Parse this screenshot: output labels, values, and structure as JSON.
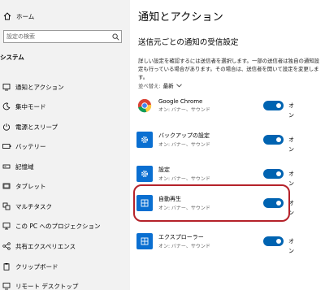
{
  "sidebar": {
    "home_label": "ホーム",
    "search_placeholder": "設定の検索",
    "section_title": "システム",
    "items": [
      {
        "label": "通知とアクション",
        "icon": "notification-icon"
      },
      {
        "label": "集中モード",
        "icon": "moon-icon"
      },
      {
        "label": "電源とスリープ",
        "icon": "power-icon"
      },
      {
        "label": "バッテリー",
        "icon": "battery-icon"
      },
      {
        "label": "記憶域",
        "icon": "storage-icon"
      },
      {
        "label": "タブレット",
        "icon": "tablet-icon"
      },
      {
        "label": "マルチタスク",
        "icon": "multitask-icon"
      },
      {
        "label": "この PC へのプロジェクション",
        "icon": "projection-icon"
      },
      {
        "label": "共有エクスペリエンス",
        "icon": "share-icon"
      },
      {
        "label": "クリップボード",
        "icon": "clipboard-icon"
      },
      {
        "label": "リモート デスクトップ",
        "icon": "remote-desktop-icon"
      }
    ]
  },
  "main": {
    "title": "通知とアクション",
    "subtitle": "送信元ごとの通知の受信設定",
    "description": "詳しい設定を確認するには送信者を選択します。一部の送信者は独自の通知設定も行っている場合があります。その場合は、送信者を開いて設定を変更します。",
    "sort_label": "並べ替え:",
    "sort_value": "最新",
    "apps": [
      {
        "name": "Google Chrome",
        "sub": "オン: バナー、サウンド",
        "toggle_label": "オン",
        "on": true,
        "icon": "chrome-icon"
      },
      {
        "name": "バックアップの設定",
        "sub": "オン: バナー、サウンド",
        "toggle_label": "オン",
        "on": true,
        "icon": "gear-icon"
      },
      {
        "name": "設定",
        "sub": "オン: バナー、サウンド",
        "toggle_label": "オン",
        "on": true,
        "icon": "gear-icon"
      },
      {
        "name": "自動再生",
        "sub": "オン: バナー、サウンド",
        "toggle_label": "オン",
        "on": true,
        "icon": "autoplay-icon"
      },
      {
        "name": "エクスプローラー",
        "sub": "オン: バナー、サウンド",
        "toggle_label": "オン",
        "on": true,
        "icon": "explorer-icon"
      }
    ]
  },
  "colors": {
    "accent": "#0063b1",
    "app_tile": "#0a6fd1",
    "highlight": "#b5222a",
    "sidebar_bg": "#f2f2f2"
  }
}
